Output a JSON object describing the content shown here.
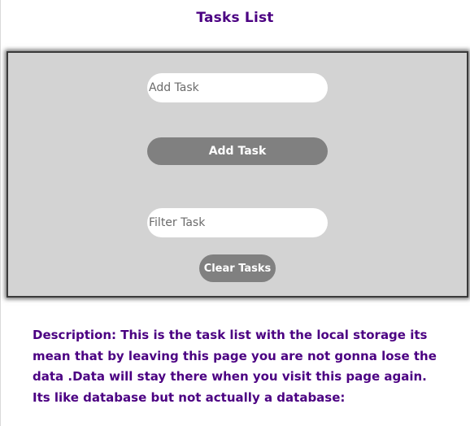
{
  "page": {
    "title": "Tasks List"
  },
  "form": {
    "add_task_placeholder": "Add Task",
    "add_task_button": "Add Task",
    "filter_task_placeholder": "Filter Task",
    "clear_tasks_button": "Clear Tasks"
  },
  "description": {
    "text": "Description: This is the task list with the local storage its mean that by leaving this page you are not gonna lose the data .Data will stay there when you visit this page again. Its like database but not actually a database:"
  },
  "colors": {
    "title": "#4b0082",
    "panel_background": "#d3d3d3",
    "button_background": "#808080",
    "button_text": "#ffffff"
  }
}
